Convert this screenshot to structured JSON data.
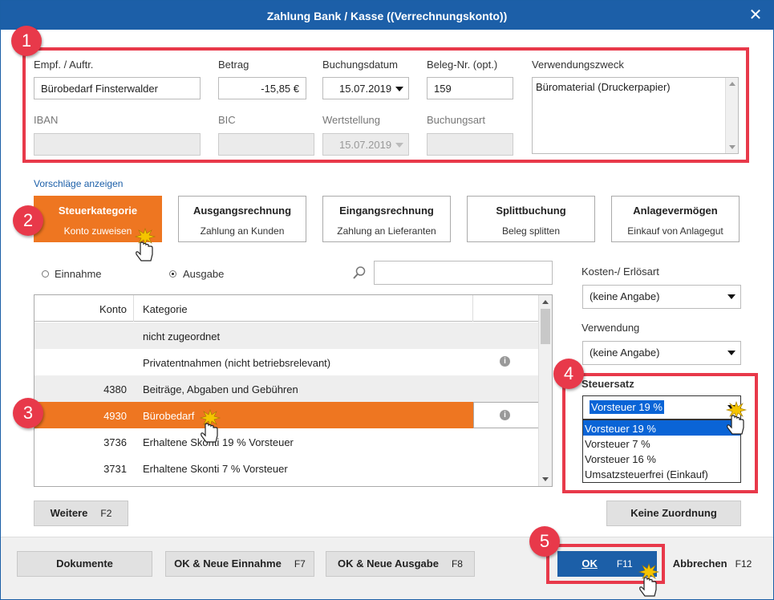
{
  "window": {
    "title": "Zahlung Bank / Kasse ((Verrechnungskonto))",
    "close": "✕"
  },
  "badges": [
    "1",
    "2",
    "3",
    "4",
    "5"
  ],
  "form": {
    "empf_label": "Empf. / Auftr.",
    "empf_value": "Bürobedarf Finsterwalder",
    "betrag_label": "Betrag",
    "betrag_value": "-15,85 €",
    "buchungsdatum_label": "Buchungsdatum",
    "buchungsdatum_value": "15.07.2019",
    "beleg_label": "Beleg-Nr. (opt.)",
    "beleg_value": "159",
    "zweck_label": "Verwendungszweck",
    "zweck_value": "Büromaterial (Druckerpapier)",
    "iban_label": "IBAN",
    "bic_label": "BIC",
    "wert_label": "Wertstellung",
    "wert_value": "15.07.2019",
    "buchungsart_label": "Buchungsart"
  },
  "suggestions_link": "Vorschläge anzeigen",
  "tiles": [
    {
      "title": "Steuerkategorie",
      "sub": "Konto zuweisen"
    },
    {
      "title": "Ausgangsrechnung",
      "sub": "Zahlung an Kunden"
    },
    {
      "title": "Eingangsrechnung",
      "sub": "Zahlung an Lieferanten"
    },
    {
      "title": "Splittbuchung",
      "sub": "Beleg splitten"
    },
    {
      "title": "Anlagevermögen",
      "sub": "Einkauf von Anlagegut"
    }
  ],
  "filter": {
    "einnahme": "Einnahme",
    "ausgabe": "Ausgabe",
    "selected": "Ausgabe"
  },
  "table": {
    "col_konto": "Konto",
    "col_kategorie": "Kategorie",
    "rows": [
      {
        "konto": "",
        "kategorie": "nicht zugeordnet"
      },
      {
        "konto": "",
        "kategorie": "Privatentnahmen  (nicht betriebsrelevant)"
      },
      {
        "konto": "4380",
        "kategorie": "Beiträge, Abgaben und Gebühren"
      },
      {
        "konto": "4930",
        "kategorie": "Bürobedarf"
      },
      {
        "konto": "3736",
        "kategorie": "Erhaltene Skonti 19 % Vorsteuer"
      },
      {
        "konto": "3731",
        "kategorie": "Erhaltene Skonti 7 % Vorsteuer"
      }
    ],
    "selected_row": 3
  },
  "side": {
    "kosten_label": "Kosten-/ Erlösart",
    "kosten_value": "(keine Angabe)",
    "verwendung_label": "Verwendung",
    "verwendung_value": "(keine Angabe)",
    "steuersatz_label": "Steuersatz",
    "steuersatz_value": "Vorsteuer 19 %",
    "steuersatz_options": [
      "Vorsteuer 19 %",
      "Vorsteuer 7 %",
      "Vorsteuer 16 %",
      "Umsatzsteuerfrei (Einkauf)"
    ]
  },
  "buttons": {
    "weitere": "Weitere",
    "weitere_key": "F2",
    "keine_zuordnung": "Keine Zuordnung",
    "dokumente": "Dokumente",
    "ok_neue_einnahme": "OK & Neue Einnahme",
    "ok_neue_einnahme_key": "F7",
    "ok_neue_ausgabe": "OK & Neue Ausgabe",
    "ok_neue_ausgabe_key": "F8",
    "ok": "OK",
    "ok_key": "F11",
    "abbrechen": "Abbrechen",
    "abbrechen_key": "F12"
  },
  "colors": {
    "titlebar": "#1c5fa8",
    "accent": "#ee7621",
    "annotation": "#e8394a",
    "selection": "#0a64d6"
  }
}
